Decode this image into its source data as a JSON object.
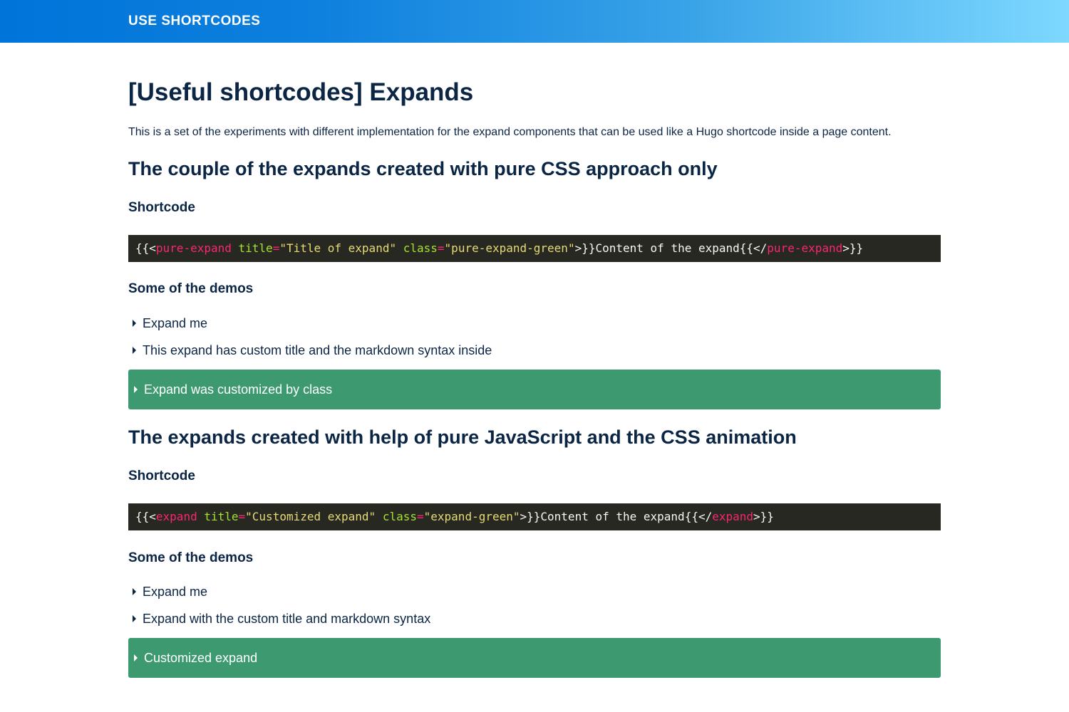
{
  "header": {
    "site_title": "USE SHORTCODES",
    "gradient_start": "#0074d9",
    "gradient_end": "#7ed8ff"
  },
  "page": {
    "title": "[Useful shortcodes] Expands",
    "intro": "This is a set of the experiments with different implementation for the expand components that can be used like a Hugo shortcode inside a page content."
  },
  "sections": [
    {
      "heading": "The couple of the expands created with pure CSS approach only",
      "shortcode_heading": "Shortcode",
      "code": {
        "open": "{{<",
        "tag": "pure-expand",
        "attr1": "title",
        "eq1": "=",
        "val1": "\"Title of expand\"",
        "attr2": "class",
        "eq2": "=",
        "val2": "\"pure-expand-green\"",
        "mid": ">}}Content of the expand{{</",
        "close_tag": "pure-expand",
        "end": ">}}"
      },
      "demos_heading": "Some of the demos",
      "demos": [
        "Expand me",
        "This expand has custom title and the markdown syntax inside"
      ],
      "green_demo": "Expand was customized by class"
    },
    {
      "heading": "The expands created with help of pure JavaScript and the CSS animation",
      "shortcode_heading": "Shortcode",
      "code": {
        "open": "{{<",
        "tag": "expand",
        "attr1": "title",
        "eq1": "=",
        "val1": "\"Customized expand\"",
        "attr2": "class",
        "eq2": "=",
        "val2": "\"expand-green\"",
        "mid": ">}}Content of the expand{{</",
        "close_tag": "expand",
        "end": ">}}"
      },
      "demos_heading": "Some of the demos",
      "demos": [
        "Expand me",
        "Expand with the custom title and markdown syntax"
      ],
      "green_demo": "Customized expand"
    }
  ],
  "colors": {
    "text": "#0b2545",
    "code_bg": "#272822",
    "code_tag": "#f92672",
    "code_attr": "#a6e22e",
    "code_string": "#e6db74",
    "expand_green": "#3d9970"
  },
  "icons": {
    "expand_toggle": "caret-right-icon"
  }
}
